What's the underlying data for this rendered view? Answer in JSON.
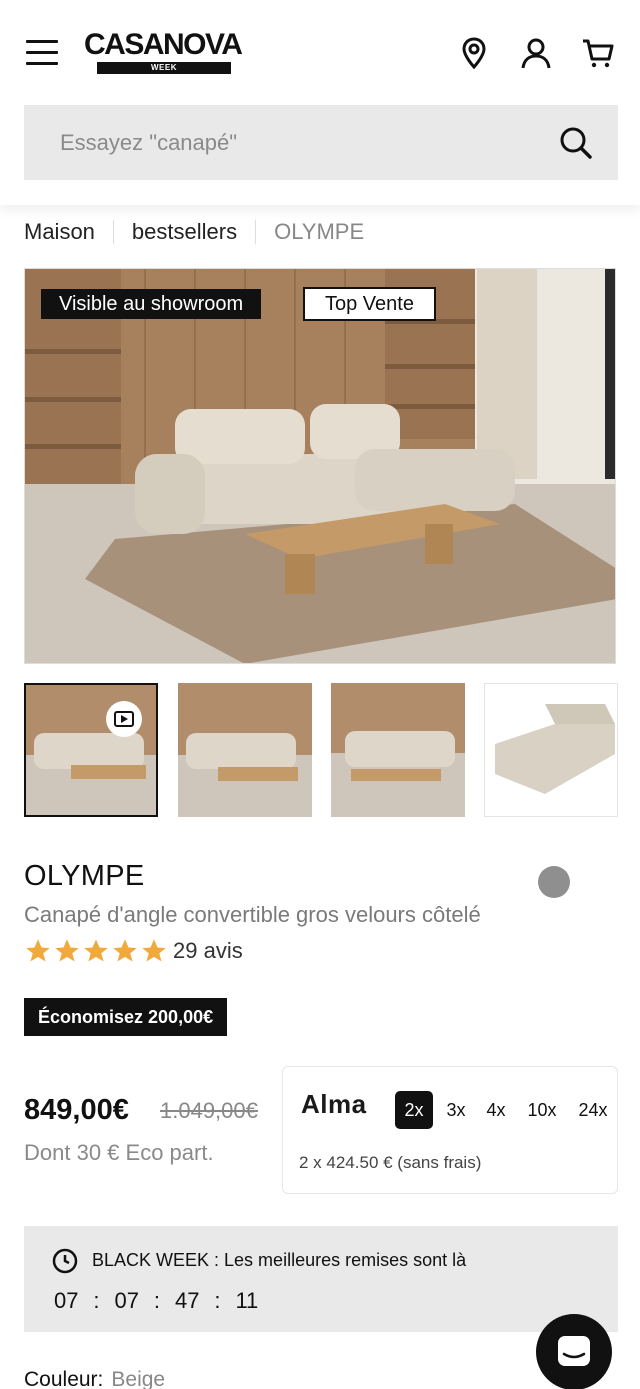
{
  "header": {
    "logo_text": "CASANOVA",
    "logo_sub": "WEEK",
    "icons": [
      "menu-icon",
      "location-pin-icon",
      "user-icon",
      "cart-icon"
    ]
  },
  "search": {
    "placeholder": "Essayez \"canapé\""
  },
  "breadcrumb": [
    "Maison",
    "bestsellers",
    "OLYMPE"
  ],
  "image_badges": {
    "showroom": "Visible au showroom",
    "top": "Top Vente"
  },
  "product": {
    "name": "OLYMPE",
    "subtitle": "Canapé d'angle convertible gros velours côtelé",
    "rating": 5,
    "reviews": "29 avis",
    "save_badge": "Économisez 200,00€",
    "price": "849,00€",
    "old_price": "1.049,00€",
    "eco": "Dont 30 € Eco part.",
    "color_label": "Couleur:",
    "color_value": "Beige",
    "swatch_color": "#8f8f8f"
  },
  "alma": {
    "logo": "Alma",
    "options": [
      "2x",
      "3x",
      "4x",
      "10x",
      "24x"
    ],
    "selected": "2x",
    "note": "2 x 424.50 € (sans frais)"
  },
  "countdown": {
    "text": "BLACK WEEK : Les meilleures remises sont là",
    "hours": "07",
    "minutes": "07",
    "seconds": "47",
    "frames": "11"
  },
  "colors": {
    "star": "#f2a93b",
    "accent": "#111111"
  }
}
